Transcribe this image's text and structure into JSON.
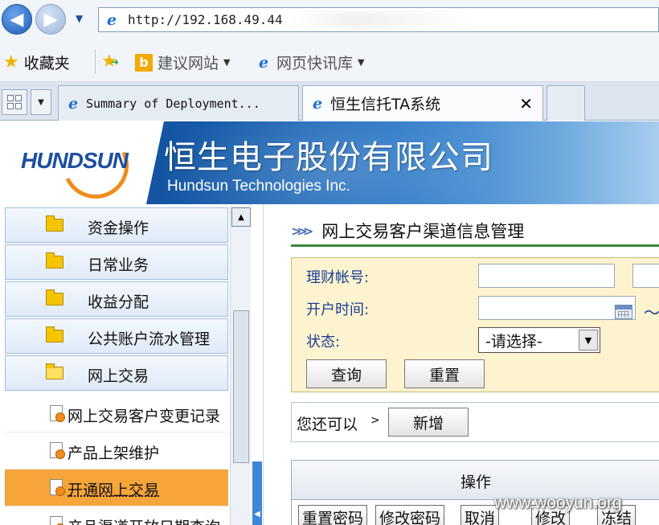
{
  "browser": {
    "address": "http://192.168.49.44",
    "favorites": {
      "label": "收藏夹",
      "suggested_sites": "建议网站",
      "web_slice": "网页快讯库"
    },
    "tabs": [
      {
        "label": "Summary of Deployment..."
      },
      {
        "label": "恒生信托TA系统",
        "close": "✕"
      }
    ]
  },
  "banner": {
    "logo": "HUNDSUN",
    "company_cn": "恒生电子股份有限公司",
    "company_en": "Hundsun Technologies Inc."
  },
  "sidebar": {
    "menu": [
      {
        "label": "资金操作"
      },
      {
        "label": "日常业务"
      },
      {
        "label": "收益分配"
      },
      {
        "label": "公共账户流水管理"
      },
      {
        "label": "网上交易"
      }
    ],
    "submenu": [
      {
        "label": "网上交易客户变更记录"
      },
      {
        "label": "产品上架维护"
      },
      {
        "label": "开通网上交易"
      },
      {
        "label": "产品渠道开放日期查询"
      }
    ]
  },
  "main": {
    "title": "网上交易客户渠道信息管理",
    "search": {
      "account_label": "理财帐号:",
      "account_value": "",
      "open_time_label": "开户时间:",
      "open_time_value": "",
      "range_sep": "～",
      "status_label": "状态:",
      "status_value": "-请选择-",
      "query_button": "查询",
      "reset_button": "重置"
    },
    "extra": {
      "text": "您还可以",
      "gt": ">",
      "add_button": "新增"
    },
    "grid": {
      "header": "操作",
      "buttons": [
        "重置密码",
        "修改密码",
        "取消",
        "修改",
        "冻结"
      ]
    }
  },
  "watermark": "www.wooyun.org",
  "colors": {
    "banner_dark": "#0c3f88",
    "active_item": "#f5a53a",
    "search_panel": "#fdf3cf",
    "label_blue": "#1b3f99",
    "title_line": "#3a8a3a"
  }
}
